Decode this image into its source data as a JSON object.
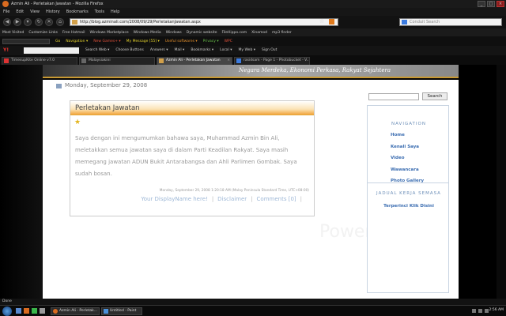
{
  "window": {
    "title": "Azmin Ali - Perletakan Jawatan - Mozilla Firefox"
  },
  "menu": [
    "File",
    "Edit",
    "View",
    "History",
    "Bookmarks",
    "Tools",
    "Help"
  ],
  "nav": {
    "url": "http://blog.azminali.com/2008/09/29/PerletakanJawatan.aspx",
    "search_placeholder": "Conduit Search"
  },
  "bookmarks": [
    "Most Visited",
    "Customize Links",
    "Free Hotmail",
    "Windows Marketplace",
    "Windows Media",
    "Windows",
    "Dynamic website",
    "FileHippo.com",
    "Xinamod",
    "mp3 finder"
  ],
  "toolbar1": {
    "go": "Go",
    "navigation": "Navigation ▾",
    "games": "New Games+ ▾",
    "message": "My Message [55] ▾",
    "software": "Useful softwares ▾",
    "privacy": "Privacy ▾",
    "wpc": "WPC"
  },
  "toolbar2": {
    "items": [
      "Search Web ▾",
      "Choose Buttons",
      "Answers ▾",
      "Mail ▾",
      "Bookmarks ▾",
      "Local ▾",
      "My Web ▾",
      "Sign Out"
    ]
  },
  "tabs": [
    {
      "label": "TimesupKite Online v7.0",
      "active": false
    },
    {
      "label": "Malaysiakini",
      "active": false
    },
    {
      "label": "Azmin Ali - Perletakan Jawatan",
      "active": true
    },
    {
      "label": "rasidsam - Page 1 - Photobucket - V...",
      "active": false
    }
  ],
  "blog": {
    "tagline": "Negara Merdeka, Ekonomi Perkasa, Rakyat Sejahtera",
    "date": "Monday, September 29, 2008",
    "post": {
      "title": "Perletakan Jawatan",
      "body": "Saya dengan ini mengumumkan bahawa saya, Muhammad Azmin Bin Ali, meletakkan semua jawatan saya di dalam Parti Keadilan Rakyat. Saya masih memegang jawatan ADUN Bukit Antarabangsa dan Ahli Parlimen Gombak. Saya sudah bosan.",
      "meta": "Monday, September 29, 2008 1:20:18 AM (Malay Peninsula Standard Time, UTC+08:00)",
      "links": [
        "Your DisplayName here!",
        "Disclaimer",
        "Comments [0]"
      ]
    },
    "sidebar": {
      "search_button": "Search",
      "nav_heading": "NAVIGATION",
      "nav_items": [
        "Home",
        "Kenali Saya",
        "Video",
        "Wawancara",
        "Photo Gallery"
      ],
      "schedule_heading": "JADUAL KERJA SEMASA",
      "schedule_link": "Terperinci Klik Disini"
    },
    "watermark": "Powered..."
  },
  "status": "Done",
  "taskbar": {
    "buttons": [
      "Azmin Ali - Perletak...",
      "Untitled - Paint"
    ],
    "clock": "2:56 AM"
  }
}
